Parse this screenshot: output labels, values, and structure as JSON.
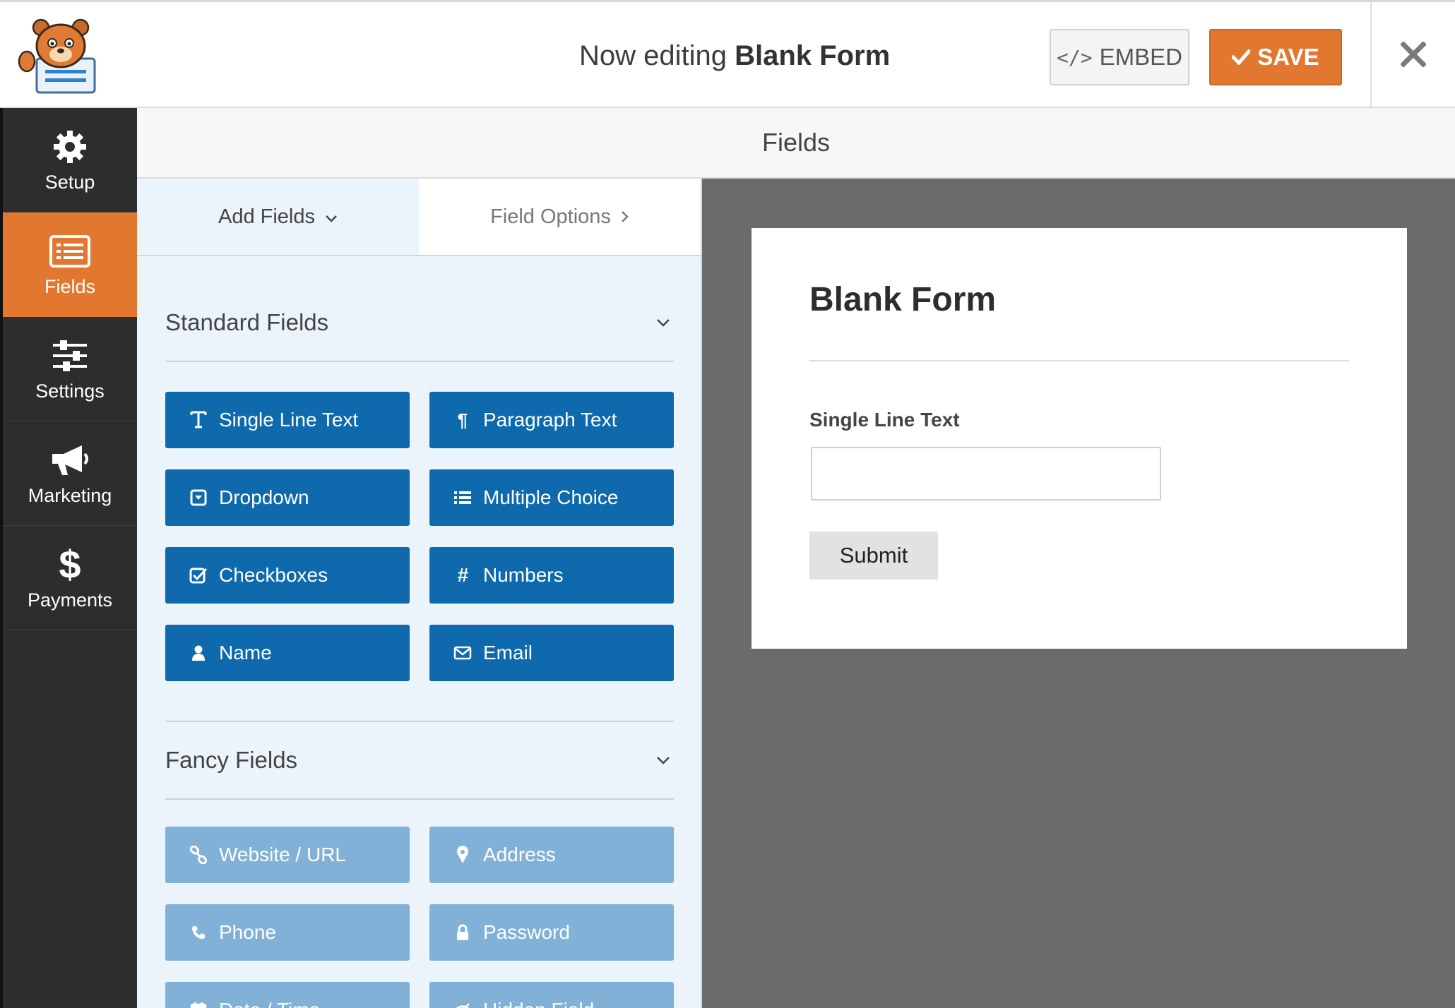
{
  "header": {
    "prefix": "Now editing",
    "form_name": "Blank Form",
    "embed_label": "EMBED",
    "save_label": "SAVE"
  },
  "sidebar": {
    "items": [
      {
        "label": "Setup",
        "icon": "gear-icon"
      },
      {
        "label": "Fields",
        "icon": "fields-list-icon",
        "active": true
      },
      {
        "label": "Settings",
        "icon": "sliders-icon"
      },
      {
        "label": "Marketing",
        "icon": "megaphone-icon"
      },
      {
        "label": "Payments",
        "icon": "dollar-icon"
      }
    ]
  },
  "section": {
    "title": "Fields"
  },
  "tabs": {
    "add_fields": "Add Fields",
    "field_options": "Field Options"
  },
  "standard": {
    "title": "Standard Fields",
    "buttons": [
      {
        "label": "Single Line Text",
        "icon": "text-icon"
      },
      {
        "label": "Paragraph Text",
        "icon": "paragraph-icon"
      },
      {
        "label": "Dropdown",
        "icon": "dropdown-icon"
      },
      {
        "label": "Multiple Choice",
        "icon": "list-icon"
      },
      {
        "label": "Checkboxes",
        "icon": "checkbox-icon"
      },
      {
        "label": "Numbers",
        "icon": "hash-icon"
      },
      {
        "label": "Name",
        "icon": "user-icon"
      },
      {
        "label": "Email",
        "icon": "envelope-icon"
      }
    ]
  },
  "fancy": {
    "title": "Fancy Fields",
    "buttons": [
      {
        "label": "Website / URL",
        "icon": "link-icon"
      },
      {
        "label": "Address",
        "icon": "map-pin-icon"
      },
      {
        "label": "Phone",
        "icon": "phone-icon"
      },
      {
        "label": "Password",
        "icon": "lock-icon"
      },
      {
        "label": "Date / Time",
        "icon": "calendar-icon"
      },
      {
        "label": "Hidden Field",
        "icon": "eye-slash-icon"
      }
    ]
  },
  "preview": {
    "form_title": "Blank Form",
    "field_label": "Single Line Text",
    "submit_label": "Submit"
  },
  "colors": {
    "accent_orange": "#e27730",
    "field_button_blue": "#0e6aad",
    "fancy_button_blue": "#82b1d7",
    "sidebar_dark": "#2d2d2d",
    "preview_bg": "#6b6b6b"
  }
}
